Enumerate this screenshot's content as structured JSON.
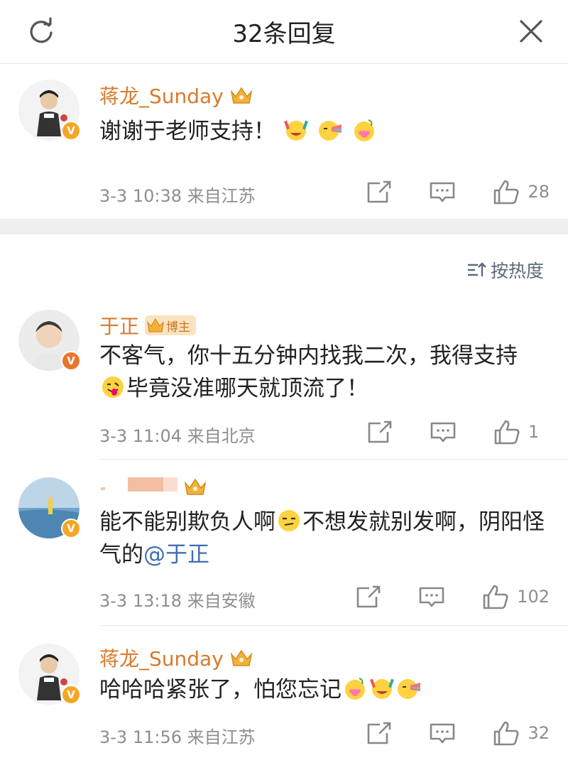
{
  "header": {
    "title": "32条回复"
  },
  "op_comment": {
    "username": "蒋龙_Sunday",
    "text": "谢谢于老师支持！",
    "date": "3-3",
    "time": "10:38",
    "location": "来自江苏",
    "likes": "28"
  },
  "sort": {
    "label": "按热度"
  },
  "replies": [
    {
      "username": "于正",
      "badge_label": "博主",
      "text_1": "不客气，你十五分钟内找我二次，我得支持",
      "text_2": "毕竟没准哪天就顶流了！",
      "date": "3-3",
      "time": "11:04",
      "location": "来自北京",
      "likes": "1"
    },
    {
      "username": "",
      "text_1": "能不能别欺负人啊",
      "text_2": "不想发就别发啊，阴阳怪气的",
      "mention": "@于正",
      "date": "3-3",
      "time": "13:18",
      "location": "来自安徽",
      "likes": "102"
    },
    {
      "username": "蒋龙_Sunday",
      "text": "哈哈哈紧张了，怕您忘记",
      "date": "3-3",
      "time": "11:56",
      "location": "来自江苏",
      "likes": "32"
    }
  ],
  "colors": {
    "username": "#d97a2b",
    "mention": "#3f6fb1",
    "meta": "#8e8e8e",
    "verified_gold": "#f5a623",
    "verified_orange": "#e8762b"
  },
  "icons": [
    "refresh-icon",
    "close-icon",
    "crown-icon",
    "share-icon",
    "reply-icon",
    "like-icon",
    "sort-icon",
    "verified-icon"
  ]
}
